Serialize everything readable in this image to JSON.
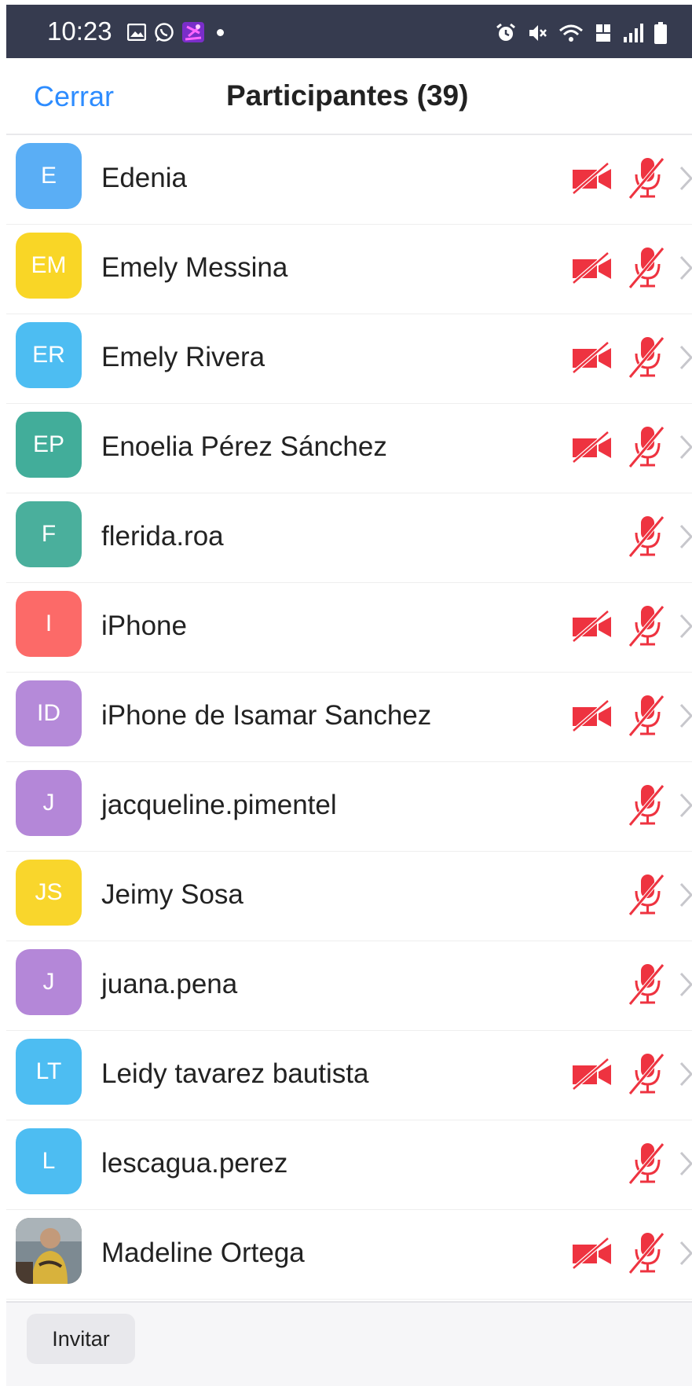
{
  "status_bar": {
    "time": "10:23",
    "left_icons": [
      "gallery-icon",
      "whatsapp-icon",
      "app-icon",
      "dot-icon"
    ],
    "right_icons": [
      "alarm-icon",
      "mute-icon",
      "wifi-icon",
      "volte-icon",
      "signal-icon",
      "battery-icon"
    ]
  },
  "header": {
    "close_label": "Cerrar",
    "title": "Participantes (39)"
  },
  "participants": [
    {
      "initials": "E",
      "name": "Edenia",
      "color": "#5aaef5",
      "video_off": true,
      "mic_muted": true
    },
    {
      "initials": "EM",
      "name": "Emely Messina",
      "color": "#f9d626",
      "video_off": true,
      "mic_muted": true
    },
    {
      "initials": "ER",
      "name": "Emely Rivera",
      "color": "#4dbdf2",
      "video_off": true,
      "mic_muted": true
    },
    {
      "initials": "EP",
      "name": "Enoelia Pérez Sánchez",
      "color": "#42ad9a",
      "video_off": true,
      "mic_muted": true
    },
    {
      "initials": "F",
      "name": "flerida.roa",
      "color": "#4aaf9c",
      "video_off": false,
      "mic_muted": true
    },
    {
      "initials": "I",
      "name": "iPhone",
      "color": "#fc6a68",
      "video_off": true,
      "mic_muted": true
    },
    {
      "initials": "ID",
      "name": "iPhone de Isamar Sanchez",
      "color": "#b58ad9",
      "video_off": true,
      "mic_muted": true
    },
    {
      "initials": "J",
      "name": "jacqueline.pimentel",
      "color": "#b487d8",
      "video_off": false,
      "mic_muted": true
    },
    {
      "initials": "JS",
      "name": "Jeimy Sosa",
      "color": "#f9d62c",
      "video_off": false,
      "mic_muted": true
    },
    {
      "initials": "J",
      "name": "juana.pena",
      "color": "#b487d8",
      "video_off": false,
      "mic_muted": true
    },
    {
      "initials": "LT",
      "name": "Leidy tavarez bautista",
      "color": "#4dbdf2",
      "video_off": true,
      "mic_muted": true
    },
    {
      "initials": "L",
      "name": "lescagua.perez",
      "color": "#4dbdf2",
      "video_off": false,
      "mic_muted": true
    },
    {
      "initials": "",
      "name": "Madeline Ortega",
      "color": "#8a7356",
      "photo": true,
      "video_off": true,
      "mic_muted": true
    }
  ],
  "footer": {
    "invite_label": "Invitar"
  },
  "colors": {
    "accent": "#2d8cff",
    "muted_red": "#ee3340",
    "status_bar": "#363b4f"
  }
}
